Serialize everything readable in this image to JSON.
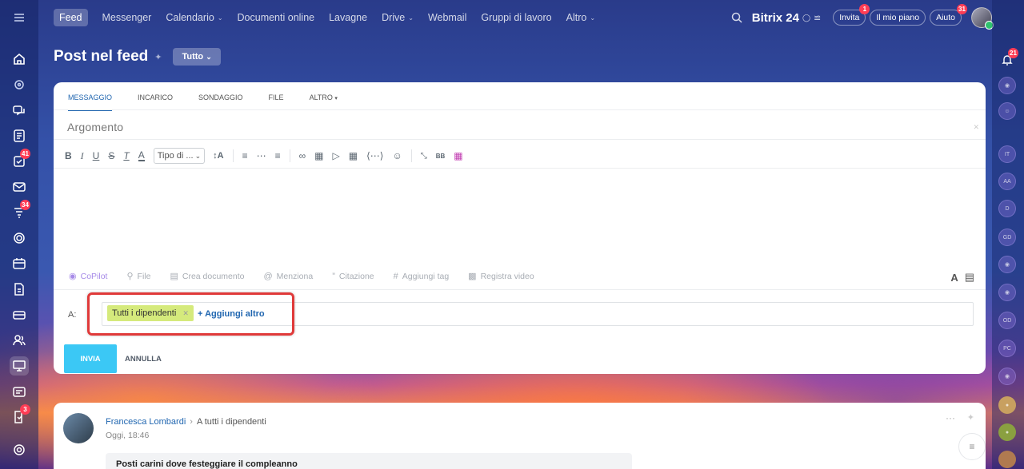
{
  "topnav": {
    "active": "Feed",
    "items": [
      {
        "label": "Messenger",
        "dropdown": false
      },
      {
        "label": "Calendario",
        "dropdown": true
      },
      {
        "label": "Documenti online",
        "dropdown": false
      },
      {
        "label": "Lavagne",
        "dropdown": false
      },
      {
        "label": "Drive",
        "dropdown": true
      },
      {
        "label": "Webmail",
        "dropdown": false
      },
      {
        "label": "Gruppi di lavoro",
        "dropdown": false
      },
      {
        "label": "Altro",
        "dropdown": true
      }
    ],
    "logo": "Bitrix 24",
    "invite": "Invita",
    "invite_badge": "1",
    "plan": "Il mio piano",
    "help": "Aiuto",
    "help_badge": "31"
  },
  "sidebar_badges": {
    "tasks": "41",
    "feed": "34",
    "approvals": "3"
  },
  "right_badges": {
    "notifications": "21"
  },
  "page": {
    "title": "Post nel feed",
    "filter": "Tutto"
  },
  "composer": {
    "tabs": [
      "MESSAGGIO",
      "INCARICO",
      "SONDAGGIO",
      "FILE",
      "ALTRO"
    ],
    "topic_placeholder": "Argomento",
    "font_select": "Tipo di ...",
    "bottom_tools": [
      "CoPilot",
      "File",
      "Crea documento",
      "Menziona",
      "Citazione",
      "Aggiungi tag",
      "Registra video"
    ],
    "to_label": "A:",
    "recipient": "Tutti i dipendenti",
    "add_more": "+ Aggiungi altro",
    "send": "INVIA",
    "cancel": "ANNULLA"
  },
  "post": {
    "author": "Francesca Lombardi",
    "recipients": "A tutti i dipendenti",
    "time": "Oggi, 18:46",
    "text": "Posti carini dove festeggiare il compleanno"
  },
  "right_avatars": [
    "IT",
    "AA",
    "D",
    "GD",
    "OD",
    "PC"
  ],
  "colors": {
    "accent": "#2066b0",
    "send": "#3bc8f5",
    "tag": "#d5ea7c",
    "highlight": "#e03a3a"
  }
}
